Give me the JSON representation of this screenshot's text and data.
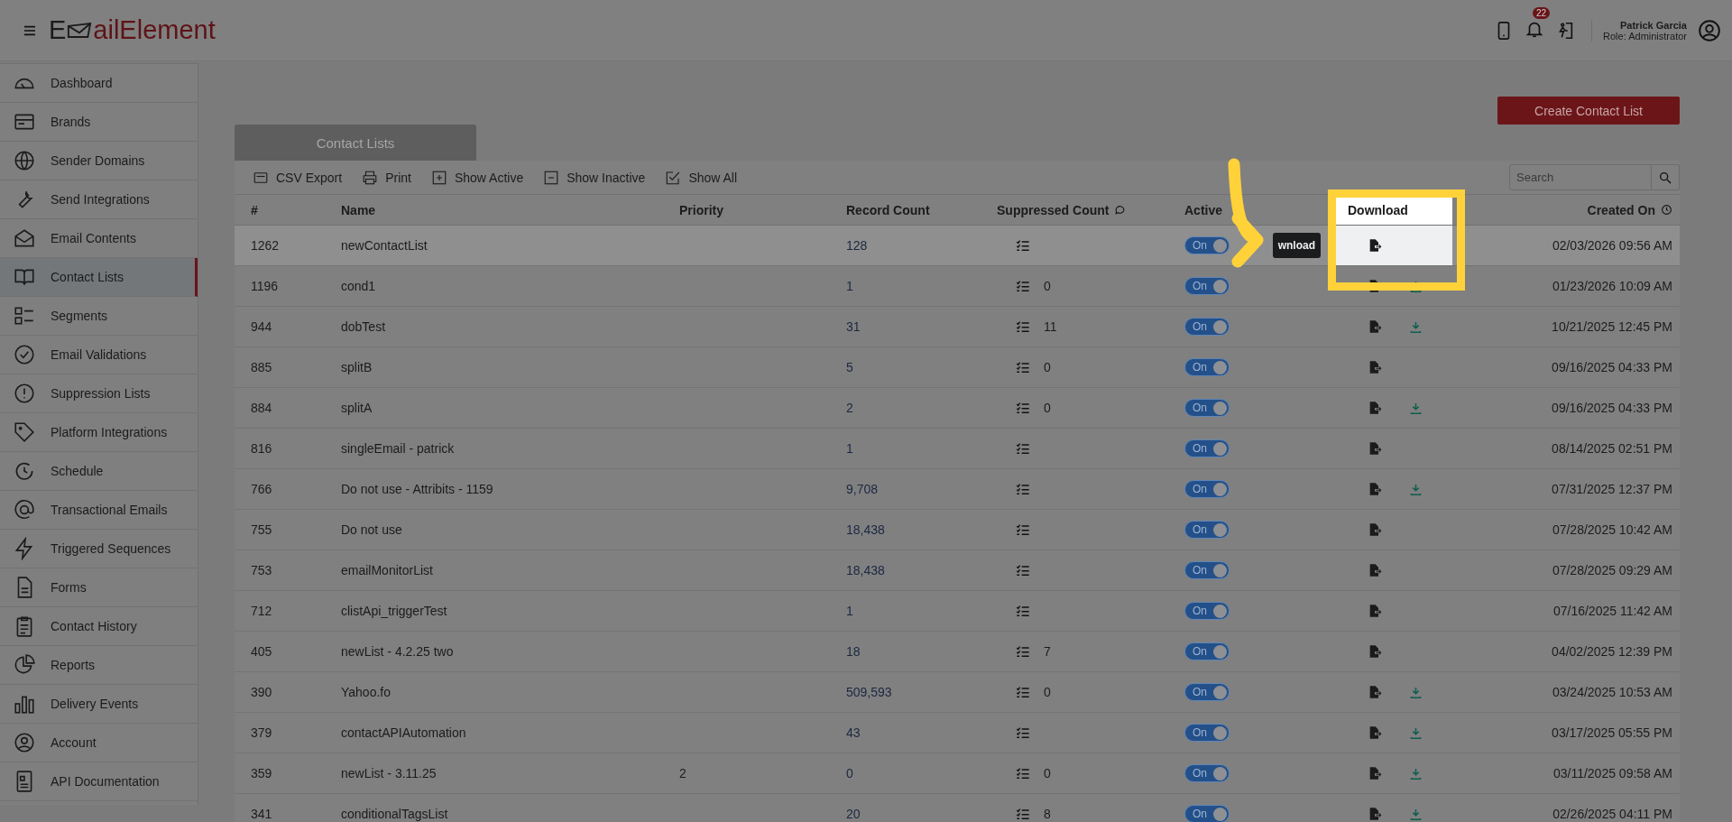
{
  "header": {
    "logo": {
      "first": "E",
      "rest": "ailElement"
    },
    "notification_count": "22",
    "user": {
      "name": "Patrick Garcia",
      "role": "Role: Administrator"
    }
  },
  "sidebar": {
    "items": [
      {
        "label": "Dashboard",
        "selected": false
      },
      {
        "label": "Brands",
        "selected": false
      },
      {
        "label": "Sender Domains",
        "selected": false
      },
      {
        "label": "Send Integrations",
        "selected": false
      },
      {
        "label": "Email Contents",
        "selected": false
      },
      {
        "label": "Contact Lists",
        "selected": true
      },
      {
        "label": "Segments",
        "selected": false
      },
      {
        "label": "Email Validations",
        "selected": false
      },
      {
        "label": "Suppression Lists",
        "selected": false
      },
      {
        "label": "Platform Integrations",
        "selected": false
      },
      {
        "label": "Schedule",
        "selected": false
      },
      {
        "label": "Transactional Emails",
        "selected": false
      },
      {
        "label": "Triggered Sequences",
        "selected": false
      },
      {
        "label": "Forms",
        "selected": false
      },
      {
        "label": "Contact History",
        "selected": false
      },
      {
        "label": "Reports",
        "selected": false
      },
      {
        "label": "Delivery Events",
        "selected": false
      },
      {
        "label": "Account",
        "selected": false
      },
      {
        "label": "API Documentation",
        "selected": false
      }
    ]
  },
  "create_button": "Create Contact List",
  "tab": "Contact Lists",
  "toolbar": [
    "CSV Export",
    "Print",
    "Show Active",
    "Show Inactive",
    "Show All"
  ],
  "search": {
    "placeholder": "Search"
  },
  "table": {
    "columns": [
      {
        "label": "#",
        "highlighted": false
      },
      {
        "label": "Name",
        "highlighted": false
      },
      {
        "label": "Priority",
        "highlighted": false
      },
      {
        "label": "Record Count",
        "highlighted": false
      },
      {
        "label": "Suppressed Count",
        "highlighted": false
      },
      {
        "label": "Active",
        "highlighted": false
      },
      {
        "label": "Download",
        "highlighted": true
      },
      {
        "label": "Created On",
        "highlighted": false
      }
    ],
    "rows": [
      {
        "id": "1262",
        "name": "newContactList",
        "priority": "",
        "records": "128",
        "suppressed": "",
        "active": true,
        "active_label": "On",
        "downloadable": false,
        "created": "02/03/2026 09:56 AM",
        "selected": true,
        "tooltip": "wnload"
      },
      {
        "id": "1196",
        "name": "cond1",
        "priority": "",
        "records": "1",
        "suppressed": "0",
        "active": true,
        "active_label": "On",
        "downloadable": true,
        "created": "01/23/2026 10:09 AM",
        "selected": false
      },
      {
        "id": "944",
        "name": "dobTest",
        "priority": "",
        "records": "31",
        "suppressed": "11",
        "active": true,
        "active_label": "On",
        "downloadable": true,
        "created": "10/21/2025 12:45 PM",
        "selected": false
      },
      {
        "id": "885",
        "name": "splitB",
        "priority": "",
        "records": "5",
        "suppressed": "0",
        "active": true,
        "active_label": "On",
        "downloadable": false,
        "created": "09/16/2025 04:33 PM",
        "selected": false
      },
      {
        "id": "884",
        "name": "splitA",
        "priority": "",
        "records": "2",
        "suppressed": "0",
        "active": true,
        "active_label": "On",
        "downloadable": true,
        "created": "09/16/2025 04:33 PM",
        "selected": false
      },
      {
        "id": "816",
        "name": "singleEmail - patrick",
        "priority": "",
        "records": "1",
        "suppressed": "",
        "active": true,
        "active_label": "On",
        "downloadable": false,
        "created": "08/14/2025 02:51 PM",
        "selected": false
      },
      {
        "id": "766",
        "name": "Do not use - Attribits - 1159",
        "priority": "",
        "records": "9,708",
        "suppressed": "",
        "active": true,
        "active_label": "On",
        "downloadable": true,
        "created": "07/31/2025 12:37 PM",
        "selected": false
      },
      {
        "id": "755",
        "name": "Do not use",
        "priority": "",
        "records": "18,438",
        "suppressed": "",
        "active": true,
        "active_label": "On",
        "downloadable": false,
        "created": "07/28/2025 10:42 AM",
        "selected": false
      },
      {
        "id": "753",
        "name": "emailMonitorList",
        "priority": "",
        "records": "18,438",
        "suppressed": "",
        "active": true,
        "active_label": "On",
        "downloadable": false,
        "created": "07/28/2025 09:29 AM",
        "selected": false
      },
      {
        "id": "712",
        "name": "clistApi_triggerTest",
        "priority": "",
        "records": "1",
        "suppressed": "",
        "active": true,
        "active_label": "On",
        "downloadable": false,
        "created": "07/16/2025 11:42 AM",
        "selected": false
      },
      {
        "id": "405",
        "name": "newList - 4.2.25 two",
        "priority": "",
        "records": "18",
        "suppressed": "7",
        "active": true,
        "active_label": "On",
        "downloadable": false,
        "created": "04/02/2025 12:39 PM",
        "selected": false
      },
      {
        "id": "390",
        "name": "Yahoo.fo",
        "priority": "",
        "records": "509,593",
        "suppressed": "0",
        "active": true,
        "active_label": "On",
        "downloadable": true,
        "created": "03/24/2025 10:53 AM",
        "selected": false
      },
      {
        "id": "379",
        "name": "contactAPIAutomation",
        "priority": "",
        "records": "43",
        "suppressed": "",
        "active": true,
        "active_label": "On",
        "downloadable": true,
        "created": "03/17/2025 05:55 PM",
        "selected": false
      },
      {
        "id": "359",
        "name": "newList - 3.11.25",
        "priority": "2",
        "records": "0",
        "suppressed": "0",
        "active": true,
        "active_label": "On",
        "downloadable": true,
        "created": "03/11/2025 09:58 AM",
        "selected": false
      },
      {
        "id": "341",
        "name": "conditionalTagsList",
        "priority": "",
        "records": "20",
        "suppressed": "8",
        "active": true,
        "active_label": "On",
        "downloadable": true,
        "created": "02/26/2025 04:11 PM",
        "selected": false
      }
    ]
  }
}
